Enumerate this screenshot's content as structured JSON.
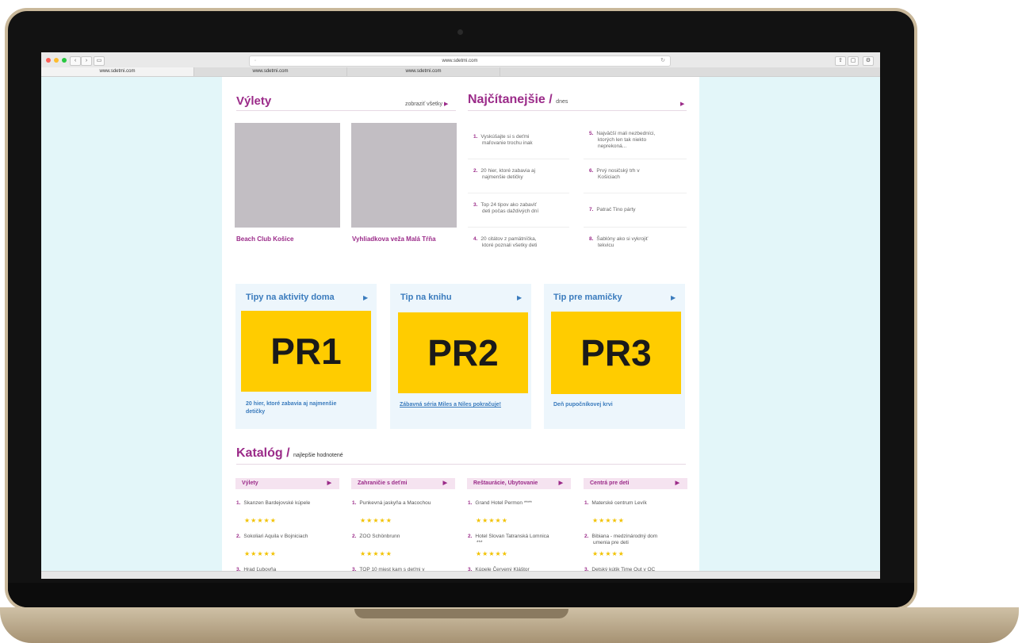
{
  "browser": {
    "url": "www.sdetmi.com",
    "tabs": [
      "www.sdetmi.com",
      "www.sdetmi.com",
      "www.sdetmi.com"
    ]
  },
  "vylety": {
    "title": "Výlety",
    "show_all": "zobraziť všetky",
    "items": [
      {
        "caption": "Beach Club Košice"
      },
      {
        "caption": "Vyhliadkova veža Malá Tŕňa"
      }
    ]
  },
  "najcitanejsie": {
    "title": "Najčítanejšie /",
    "subtitle": "dnes",
    "items": [
      {
        "num": "1.",
        "text_l1": "Vyskúšajte si s deťmi",
        "text_l2": "maľovanie trochu inak",
        "text_l3": ""
      },
      {
        "num": "2.",
        "text_l1": "20 hier, ktoré zabavia aj",
        "text_l2": "najmenšie detičky",
        "text_l3": ""
      },
      {
        "num": "3.",
        "text_l1": "Top 24 tipov ako zabaviť",
        "text_l2": "deti počas daždivých dní",
        "text_l3": ""
      },
      {
        "num": "4.",
        "text_l1": "20 citátov z pamätníčka,",
        "text_l2": "ktoré poznali všetky deti",
        "text_l3": ""
      },
      {
        "num": "5.",
        "text_l1": "Najväčší mali nezbedníci,",
        "text_l2": "ktorých len tak niekto",
        "text_l3": "neprekoná..."
      },
      {
        "num": "6.",
        "text_l1": "Prvý nosičský trh v",
        "text_l2": "Košiciach",
        "text_l3": ""
      },
      {
        "num": "7.",
        "text_l1": "Patrač Tino párty",
        "text_l2": "",
        "text_l3": ""
      },
      {
        "num": "8.",
        "text_l1": "Šablóny ako si vykrojiť",
        "text_l2": "tekvicu",
        "text_l3": ""
      }
    ]
  },
  "tips": [
    {
      "title": "Tipy na aktivity doma",
      "pr": "PR1",
      "link_l1": "20 hier, ktoré zabavia aj najmenšie",
      "link_l2": "detičky"
    },
    {
      "title": "Tip na knihu",
      "pr": "PR2",
      "link_l1": "Zábavná séria Miles a Niles pokračuje!",
      "link_l2": ""
    },
    {
      "title": "Tip pre mamičky",
      "pr": "PR3",
      "link_l1": "Deň pupočníkovej krvi",
      "link_l2": ""
    }
  ],
  "katalog": {
    "title": "Katalóg /",
    "subtitle": "najlepšie hodnotené",
    "stars": "★★★★★",
    "columns": [
      {
        "head": "Výlety",
        "items": [
          {
            "num": "1.",
            "l1": "Skanzen Bardejovské kúpele",
            "l2": ""
          },
          {
            "num": "2.",
            "l1": "Sokoliari Aquila v Bojniciach",
            "l2": ""
          },
          {
            "num": "3.",
            "l1": "Hrad Ľubovňa",
            "l2": ""
          }
        ]
      },
      {
        "head": "Zahraničie s deťmi",
        "items": [
          {
            "num": "1.",
            "l1": "Punkevná jaskyňa a Macochou",
            "l2": ""
          },
          {
            "num": "2.",
            "l1": "ZOO Schönbrunn",
            "l2": ""
          },
          {
            "num": "3.",
            "l1": "TOP 10 miest kam s deťmi v",
            "l2": ""
          }
        ]
      },
      {
        "head": "Reštaurácie, Ubytovanie",
        "items": [
          {
            "num": "1.",
            "l1": "Grand Hotel Permon ****",
            "l2": ""
          },
          {
            "num": "2.",
            "l1": "Hotel Slovan Tatranská Lomnica",
            "l2": "***"
          },
          {
            "num": "3.",
            "l1": "Kúpele Červený Kláštor",
            "l2": ""
          }
        ]
      },
      {
        "head": "Centrá pre deti",
        "items": [
          {
            "num": "1.",
            "l1": "Materské centrum Levík",
            "l2": ""
          },
          {
            "num": "2.",
            "l1": "Bibiana - medzinárodný dom",
            "l2": "umenia pre deti"
          },
          {
            "num": "3.",
            "l1": "Detský kútik Time Out v OC",
            "l2": ""
          }
        ]
      }
    ]
  },
  "colors": {
    "accent": "#9b2b89",
    "tip_blue": "#3a7bbd",
    "pr_yellow": "#ffcc00",
    "bg": "#e3f6f9"
  }
}
